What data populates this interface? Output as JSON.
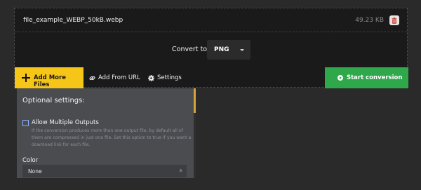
{
  "file": {
    "name": "file_example_WEBP_50kB.webp",
    "size": "49.23 KB"
  },
  "convert": {
    "label": "Convert to:",
    "format": "PNG"
  },
  "toolbar": {
    "add_files": "Add More Files",
    "add_url": "Add From URL",
    "settings": "Settings",
    "start": "Start conversion"
  },
  "settings": {
    "title": "Optional settings:",
    "multiple_outputs_label": "Allow Multiple Outputs",
    "multiple_outputs_help": "If the conversion produces more than one output file, by default all of them are compressed in just one file. Set this option to true if you want a download link for each file.",
    "multiple_outputs_checked": false,
    "color_label": "Color",
    "color_value": "None"
  },
  "colors": {
    "add_files_bg": "#f5c518",
    "start_bg": "#2ea84a",
    "delete_icon": "#c0392b",
    "checkbox_border": "#8ab4ff"
  }
}
